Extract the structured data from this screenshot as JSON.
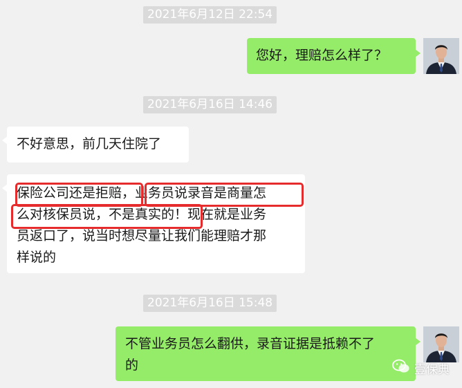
{
  "messages": [
    {
      "type": "timestamp",
      "text": "2021年6月12日 22:54"
    },
    {
      "type": "outgoing",
      "text": "您好，理赔怎么样了？",
      "avatar_icon": "user-avatar-man-in-suit"
    },
    {
      "type": "timestamp",
      "text": "2021年6月16日 14:46"
    },
    {
      "type": "incoming",
      "text": "不好意思，前几天住院了"
    },
    {
      "type": "incoming",
      "lines": [
        "保险公司还是拒赔，业务员说录音是商量怎",
        "么对核保员说，不是真实的！现在就是业务",
        "员返口了，说当时想尽量让我们能理赔才那",
        "样说的"
      ]
    },
    {
      "type": "timestamp",
      "text": "2021年6月16日 15:48"
    },
    {
      "type": "outgoing",
      "lines": [
        "不管业务员怎么翻供，录音证据是抵赖不了",
        "的"
      ],
      "avatar_icon": "user-avatar-man-in-suit"
    }
  ],
  "watermark": {
    "text": "壹保典",
    "icon": "wechat-official-account-icon"
  },
  "colors": {
    "background": "#f1f1f1",
    "outgoing_bubble": "#95ec69",
    "incoming_bubble": "#ffffff",
    "highlight": "#e52b2b",
    "timestamp_bg": "#dadada"
  }
}
